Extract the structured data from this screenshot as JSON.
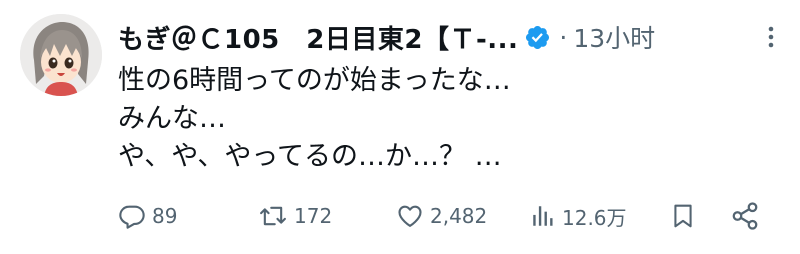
{
  "author": {
    "display_name": "もぎ＠Ｃ105　2日目東2【Ｔ-...",
    "verified": true
  },
  "separator": "·",
  "timestamp": "13小时",
  "text_lines": [
    "性の6時間ってのが始まったな…",
    "みんな…",
    "や、や、やってるの…か…？ …"
  ],
  "stats": {
    "replies": "89",
    "reposts": "172",
    "likes": "2,482",
    "views": "12.6万"
  },
  "icons": {
    "reply": "reply-icon",
    "repost": "repost-icon",
    "like": "heart-icon",
    "views": "views-icon",
    "bookmark": "bookmark-icon",
    "share": "share-icon",
    "more": "more-dots-icon",
    "verified": "verified-badge-icon"
  },
  "colors": {
    "text": "#0f1419",
    "secondary": "#536471",
    "verified": "#1d9bf0"
  }
}
